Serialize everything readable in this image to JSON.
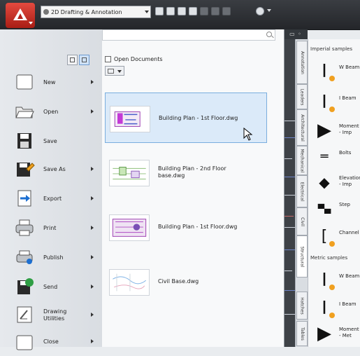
{
  "toolbar": {
    "workspace": "2D Drafting & Annotation"
  },
  "menu": {
    "items": [
      {
        "label": "New",
        "submenu": true
      },
      {
        "label": "Open",
        "submenu": true
      },
      {
        "label": "Save",
        "submenu": false
      },
      {
        "label": "Save As",
        "submenu": true
      },
      {
        "label": "Export",
        "submenu": true
      },
      {
        "label": "Print",
        "submenu": true
      },
      {
        "label": "Publish",
        "submenu": true
      },
      {
        "label": "Send",
        "submenu": true
      },
      {
        "label": "Drawing\nUtilities",
        "submenu": true
      },
      {
        "label": "Close",
        "submenu": true
      }
    ]
  },
  "documents": {
    "title": "Open Documents",
    "items": [
      {
        "name": "Building Plan - 1st Floor.dwg",
        "selected": true
      },
      {
        "name": "Building Plan - 2nd Floor\nbase.dwg",
        "selected": false
      },
      {
        "name": "Building Plan - 1st Floor.dwg",
        "selected": false
      },
      {
        "name": "Civil Base.dwg",
        "selected": false
      }
    ]
  },
  "drawing": {
    "header": "▭ ◦"
  },
  "palette_tabs": [
    "Annotation",
    "Leaders",
    "Architectural",
    "Mechanical",
    "Electrical",
    "Civil",
    "Structural",
    "Hatches",
    "Tables"
  ],
  "palette": {
    "imperial_heading": "Imperial samples",
    "metric_heading": "Metric samples",
    "items": [
      {
        "label": "W Beam",
        "icon": "i-beam-icon"
      },
      {
        "label": "I Beam",
        "icon": "i-beam-icon"
      },
      {
        "label": "Moment\n- Imp",
        "icon": "arrow-icon"
      },
      {
        "label": "Bolts",
        "icon": "bolt-icon"
      },
      {
        "label": "Elevation\n- Imp",
        "icon": "elevation-icon"
      },
      {
        "label": "Step",
        "icon": "step-icon"
      },
      {
        "label": "Channel",
        "icon": "channel-icon"
      },
      {
        "label": "W Beam",
        "icon": "i-beam-icon"
      },
      {
        "label": "I Beam",
        "icon": "i-beam-icon"
      },
      {
        "label": "Moment\n- Met",
        "icon": "arrow-icon"
      }
    ]
  },
  "colors": {
    "accent": "#cf2f25",
    "selection": "#dbeaf9"
  }
}
